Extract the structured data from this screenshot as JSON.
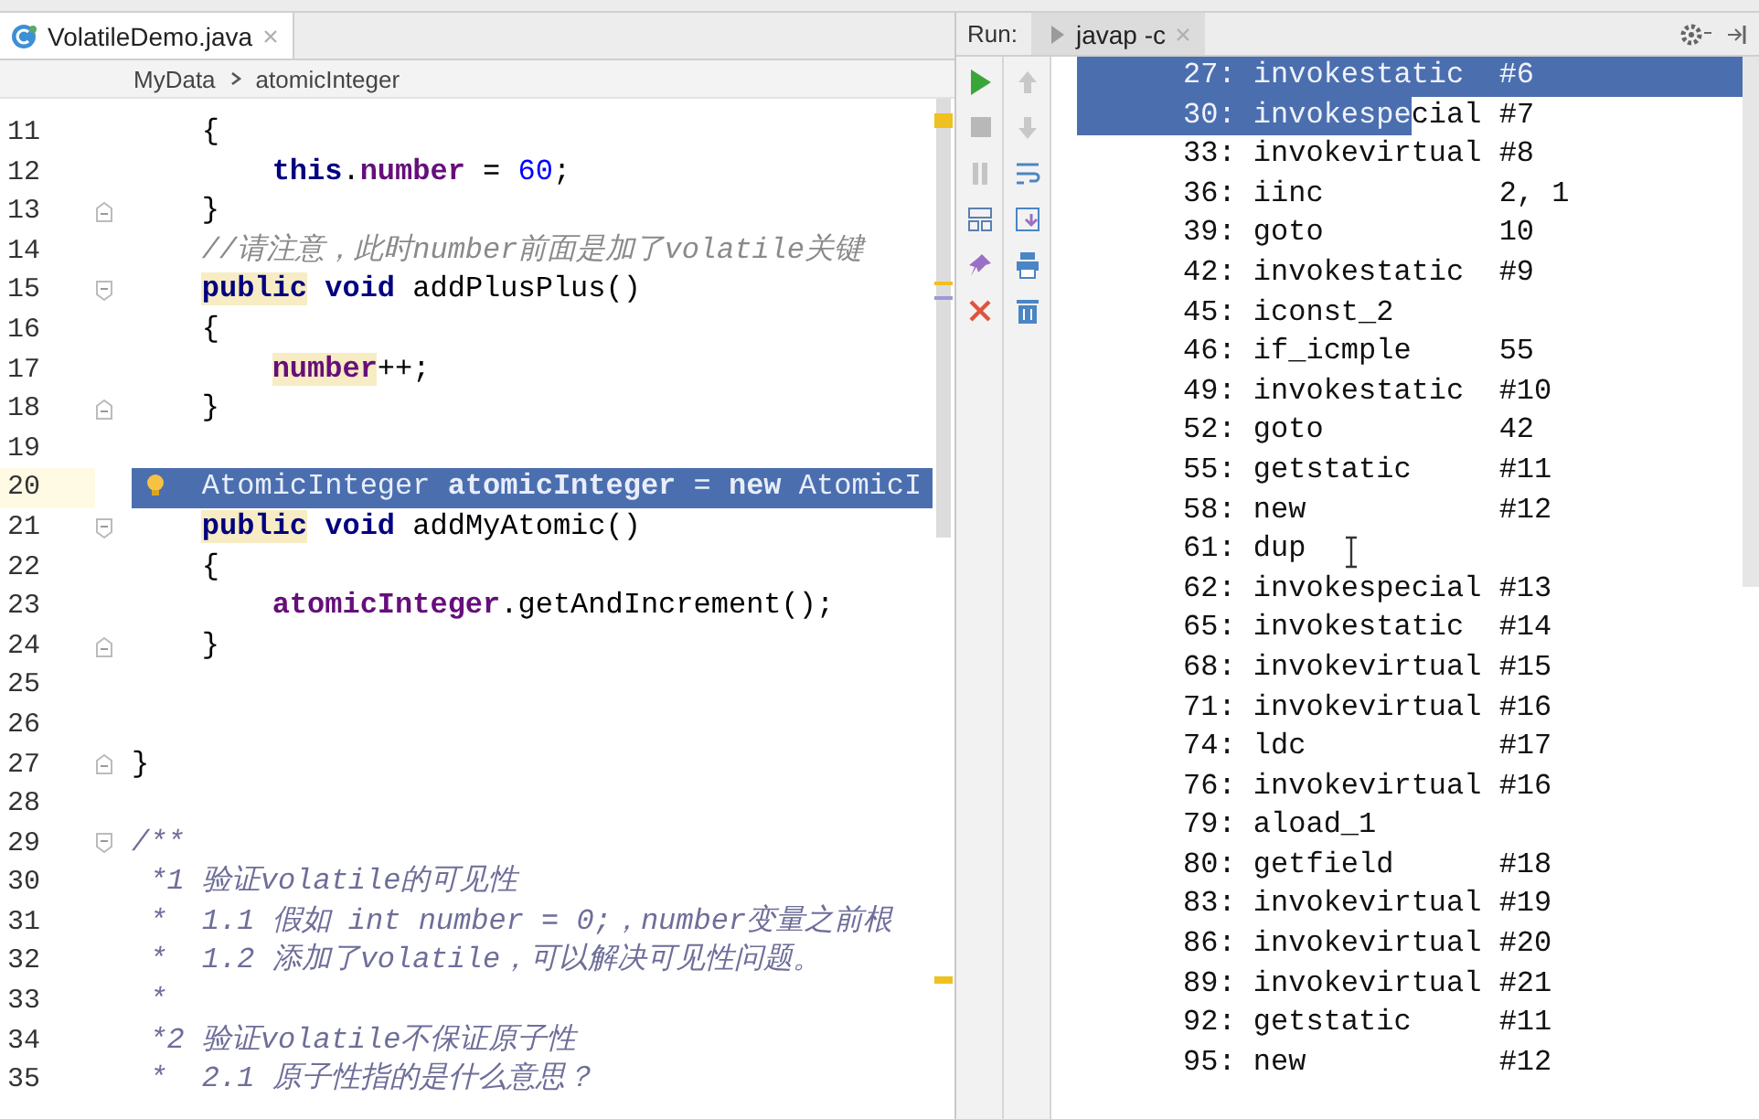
{
  "editor": {
    "tabs": [
      {
        "label": "VolatileDemo.java",
        "selected": true
      }
    ],
    "breadcrumb": [
      "MyData",
      "atomicInteger"
    ],
    "lines": [
      {
        "number": "11",
        "kind": "code",
        "tokens": [
          {
            "kind": "plain",
            "text": "    {"
          }
        ]
      },
      {
        "number": "12",
        "kind": "code",
        "tokens": [
          {
            "kind": "kw",
            "text": "        this"
          },
          {
            "kind": "plain",
            "text": "."
          },
          {
            "kind": "field",
            "text": "number"
          },
          {
            "kind": "plain",
            "text": " = "
          },
          {
            "kind": "num",
            "text": "60"
          },
          {
            "kind": "plain",
            "text": ";"
          }
        ]
      },
      {
        "number": "13",
        "kind": "foldend",
        "tokens": [
          {
            "kind": "plain",
            "text": "    }"
          }
        ]
      },
      {
        "number": "14",
        "kind": "code",
        "tokens": [
          {
            "kind": "comment",
            "text": "    //请注意，此时number前面是加了volatile关键"
          }
        ]
      },
      {
        "number": "15",
        "kind": "foldstart",
        "tokens": [
          {
            "kind": "kwmark",
            "text": "    public"
          },
          {
            "kind": "kw",
            "text": " void"
          },
          {
            "kind": "plain",
            "text": " addPlusPlus()"
          }
        ]
      },
      {
        "number": "16",
        "kind": "code",
        "tokens": [
          {
            "kind": "plain",
            "text": "    {"
          }
        ]
      },
      {
        "number": "17",
        "kind": "code",
        "tokens": [
          {
            "kind": "fieldmark",
            "text": "        number"
          },
          {
            "kind": "plain",
            "text": "++;"
          }
        ]
      },
      {
        "number": "18",
        "kind": "foldend",
        "tokens": [
          {
            "kind": "plain",
            "text": "    }"
          }
        ]
      },
      {
        "number": "19",
        "kind": "code"
      },
      {
        "number": "20",
        "kind": "code",
        "selected": true,
        "tokens": [
          {
            "kind": "plain",
            "text": "    AtomicInteger "
          },
          {
            "kind": "field",
            "text": "atomicInteger"
          },
          {
            "kind": "plain",
            "text": " = "
          },
          {
            "kind": "kw",
            "text": "new"
          },
          {
            "kind": "plain",
            "text": " AtomicI"
          }
        ]
      },
      {
        "number": "21",
        "kind": "foldstart",
        "tokens": [
          {
            "kind": "kwmark",
            "text": "    public"
          },
          {
            "kind": "kw",
            "text": " void"
          },
          {
            "kind": "plain",
            "text": " addMyAtomic()"
          }
        ]
      },
      {
        "number": "22",
        "kind": "code",
        "tokens": [
          {
            "kind": "plain",
            "text": "    {"
          }
        ]
      },
      {
        "number": "23",
        "kind": "code",
        "tokens": [
          {
            "kind": "field",
            "text": "        atomicInteger"
          },
          {
            "kind": "plain",
            "text": ".getAndIncrement();"
          }
        ]
      },
      {
        "number": "24",
        "kind": "foldend",
        "tokens": [
          {
            "kind": "plain",
            "text": "    }"
          }
        ]
      },
      {
        "number": "25",
        "kind": "code"
      },
      {
        "number": "26",
        "kind": "code"
      },
      {
        "number": "27",
        "kind": "foldend",
        "tokens": [
          {
            "kind": "plain",
            "text": "}"
          }
        ]
      },
      {
        "number": "28",
        "kind": "code"
      },
      {
        "number": "29",
        "kind": "foldstart",
        "tokens": [
          {
            "kind": "doc",
            "text": "/**"
          }
        ]
      },
      {
        "number": "30",
        "kind": "code",
        "tokens": [
          {
            "kind": "doc",
            "text": " *1 验证volatile的可见性"
          }
        ]
      },
      {
        "number": "31",
        "kind": "code",
        "tokens": [
          {
            "kind": "doc",
            "text": " *  1.1 假如 int number = 0;，number变量之前根"
          }
        ]
      },
      {
        "number": "32",
        "kind": "code",
        "tokens": [
          {
            "kind": "doc",
            "text": " *  1.2 添加了volatile，可以解决可见性问题。"
          }
        ]
      },
      {
        "number": "33",
        "kind": "code",
        "tokens": [
          {
            "kind": "doc",
            "text": " *"
          }
        ]
      },
      {
        "number": "34",
        "kind": "code",
        "tokens": [
          {
            "kind": "doc",
            "text": " *2 验证volatile不保证原子性"
          }
        ]
      },
      {
        "number": "35",
        "kind": "code",
        "tokens": [
          {
            "kind": "doc",
            "text": " *  2.1 原子性指的是什么意思？"
          }
        ]
      }
    ]
  },
  "run": {
    "label": "Run:",
    "tabs": [
      {
        "label": "javap -c",
        "selected": true
      }
    ],
    "console": [
      {
        "selected": true,
        "segments": [
          {
            "text": "27: invokestatic  #6",
            "selected": true
          }
        ]
      },
      {
        "selected": false,
        "segments": [
          {
            "text": "30: invokespe",
            "selected": true
          },
          {
            "text": "cial #7",
            "selected": false
          }
        ]
      },
      {
        "selected": false,
        "segments": [
          {
            "text": "33: invokevirtual #8",
            "selected": false
          }
        ]
      },
      {
        "selected": false,
        "segments": [
          {
            "text": "36: iinc          2, 1",
            "selected": false
          }
        ]
      },
      {
        "selected": false,
        "segments": [
          {
            "text": "39: goto          10",
            "selected": false
          }
        ]
      },
      {
        "selected": false,
        "segments": [
          {
            "text": "42: invokestatic  #9",
            "selected": false
          }
        ]
      },
      {
        "selected": false,
        "segments": [
          {
            "text": "45: iconst_2",
            "selected": false
          }
        ]
      },
      {
        "selected": false,
        "segments": [
          {
            "text": "46: if_icmple     55",
            "selected": false
          }
        ]
      },
      {
        "selected": false,
        "segments": [
          {
            "text": "49: invokestatic  #10",
            "selected": false
          }
        ]
      },
      {
        "selected": false,
        "segments": [
          {
            "text": "52: goto          42",
            "selected": false
          }
        ]
      },
      {
        "selected": false,
        "segments": [
          {
            "text": "55: getstatic     #11",
            "selected": false
          }
        ]
      },
      {
        "selected": false,
        "segments": [
          {
            "text": "58: new           #12",
            "selected": false
          }
        ]
      },
      {
        "selected": false,
        "segments": [
          {
            "text": "61: dup",
            "selected": false
          }
        ]
      },
      {
        "selected": false,
        "segments": [
          {
            "text": "62: invokespecial #13",
            "selected": false
          }
        ]
      },
      {
        "selected": false,
        "segments": [
          {
            "text": "65: invokestatic  #14",
            "selected": false
          }
        ]
      },
      {
        "selected": false,
        "segments": [
          {
            "text": "68: invokevirtual #15",
            "selected": false
          }
        ]
      },
      {
        "selected": false,
        "segments": [
          {
            "text": "71: invokevirtual #16",
            "selected": false
          }
        ]
      },
      {
        "selected": false,
        "segments": [
          {
            "text": "74: ldc           #17",
            "selected": false
          }
        ]
      },
      {
        "selected": false,
        "segments": [
          {
            "text": "76: invokevirtual #16",
            "selected": false
          }
        ]
      },
      {
        "selected": false,
        "segments": [
          {
            "text": "79: aload_1",
            "selected": false
          }
        ]
      },
      {
        "selected": false,
        "segments": [
          {
            "text": "80: getfield      #18",
            "selected": false
          }
        ]
      },
      {
        "selected": false,
        "segments": [
          {
            "text": "83: invokevirtual #19",
            "selected": false
          }
        ]
      },
      {
        "selected": false,
        "segments": [
          {
            "text": "86: invokevirtual #20",
            "selected": false
          }
        ]
      },
      {
        "selected": false,
        "segments": [
          {
            "text": "89: invokevirtual #21",
            "selected": false
          }
        ]
      },
      {
        "selected": false,
        "segments": [
          {
            "text": "92: getstatic     #11",
            "selected": false
          }
        ]
      },
      {
        "selected": false,
        "segments": [
          {
            "text": "95: new           #12",
            "selected": false
          }
        ]
      }
    ]
  }
}
